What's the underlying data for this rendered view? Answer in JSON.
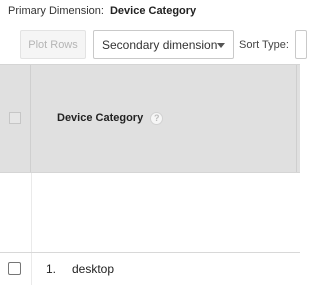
{
  "primary_dimension": {
    "label": "Primary Dimension:",
    "value": "Device Category"
  },
  "toolbar": {
    "plot_rows_label": "Plot Rows",
    "secondary_dimension_label": "Secondary dimension",
    "sort_type_label": "Sort Type:"
  },
  "table": {
    "header": {
      "column_title": "Device Category",
      "help_icon_glyph": "?"
    },
    "rows": [
      {
        "index": "1.",
        "value": "desktop"
      }
    ]
  },
  "icons": {
    "help": "question-mark-circle-icon",
    "dropdown": "caret-down-icon"
  },
  "colors": {
    "header_background": "#e0e0e0",
    "disabled_text": "#b5b5b5"
  }
}
